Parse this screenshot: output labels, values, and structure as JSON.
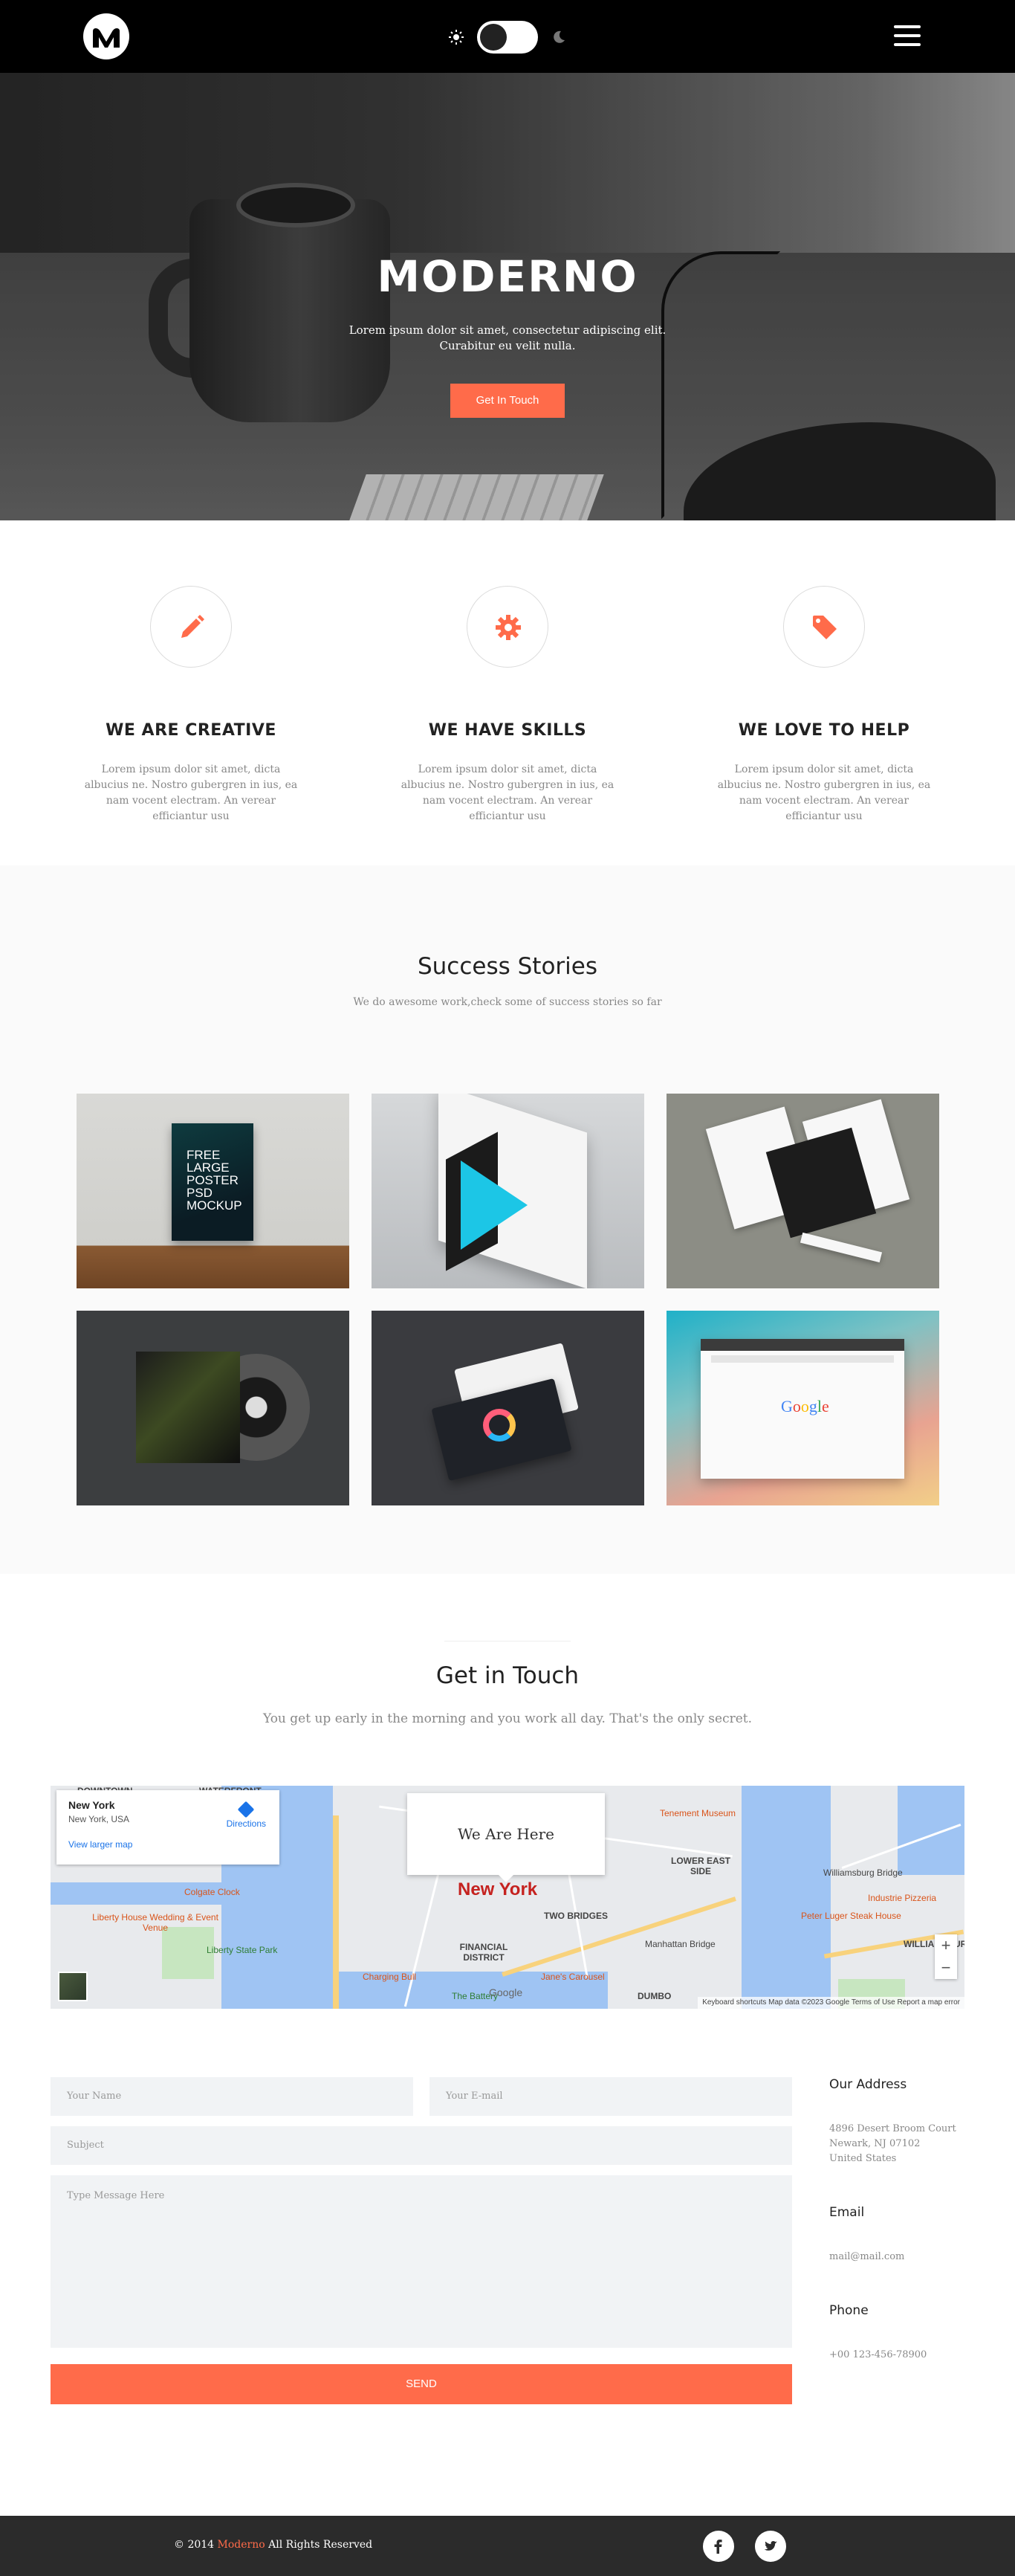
{
  "header": {
    "logo_icon": "moderno-m-logo",
    "theme_toggle": {
      "light_icon": "sun-icon",
      "dark_icon": "moon-icon",
      "state": "dark"
    },
    "menu_icon": "hamburger-icon"
  },
  "hero": {
    "title": "MODERNO",
    "text_line1": "Lorem ipsum dolor sit amet, consectetur adipiscing elit.",
    "text_line2": "Curabitur eu velit nulla.",
    "cta_label": "Get In Touch"
  },
  "features": [
    {
      "icon": "pencil-icon",
      "title": "WE ARE CREATIVE",
      "text": "Lorem ipsum dolor sit amet, dicta albucius ne. Nostro gubergren in ius, ea nam vocent electram. An verear efficiantur usu"
    },
    {
      "icon": "gear-icon",
      "title": "WE HAVE SKILLS",
      "text": "Lorem ipsum dolor sit amet, dicta albucius ne. Nostro gubergren in ius, ea nam vocent electram. An verear efficiantur usu"
    },
    {
      "icon": "tag-icon",
      "title": "WE LOVE TO HELP",
      "text": "Lorem ipsum dolor sit amet, dicta albucius ne. Nostro gubergren in ius, ea nam vocent electram. An verear efficiantur usu"
    }
  ],
  "portfolio": {
    "title": "Success Stories",
    "subtitle": "We do awesome work,check some of success stories so far",
    "poster_text": "FREE\nLARGE\nPOSTER\nPSD\nMOCKUP",
    "browser_logo": "Google"
  },
  "contact": {
    "title": "Get in Touch",
    "subtitle": "You get up early in the morning and you work all day. That's the only secret.",
    "map": {
      "place_title": "New York",
      "place_sub": "New York, USA",
      "directions": "Directions",
      "larger_map": "View larger map",
      "bubble": "We Are Here",
      "city_label": "New York",
      "labels": [
        "DOWNTOWN",
        "WATERFRONT",
        "LOWER EAST SIDE",
        "TWO BRIDGES",
        "FINANCIAL DISTRICT",
        "DUMBO",
        "WILLIAMSBURG"
      ],
      "pois": [
        "Tenement Museum",
        "Colgate Clock",
        "Liberty House Wedding & Event Venue",
        "Liberty State Park",
        "Williamsburg Bridge",
        "Industrie Pizzeria",
        "Peter Luger Steak House",
        "Manhattan Bridge",
        "Charging Bull",
        "Jane's Carousel",
        "The Battery"
      ],
      "attribution": "Keyboard shortcuts   Map data ©2023 Google   Terms of Use   Report a map error",
      "google": "Google"
    },
    "form": {
      "name_placeholder": "Your Name",
      "email_placeholder": "Your E-mail",
      "subject_placeholder": "Subject",
      "message_placeholder": "Type Message Here",
      "send_label": "SEND"
    },
    "info": {
      "address_title": "Our Address",
      "address_lines": [
        "4896 Desert Broom Court",
        "Newark, NJ 07102",
        "United States"
      ],
      "email_title": "Email",
      "email": "mail@mail.com",
      "phone_title": "Phone",
      "phone": "+00 123-456-78900"
    }
  },
  "footer": {
    "copy_prefix": "© 2014",
    "brand": "Moderno",
    "copy_suffix": "All Rights Reserved",
    "social": [
      "facebook-icon",
      "twitter-icon"
    ]
  },
  "colors": {
    "accent": "#ff6b4a",
    "header_bg": "#000000",
    "footer_bg": "#2b2b2b"
  }
}
